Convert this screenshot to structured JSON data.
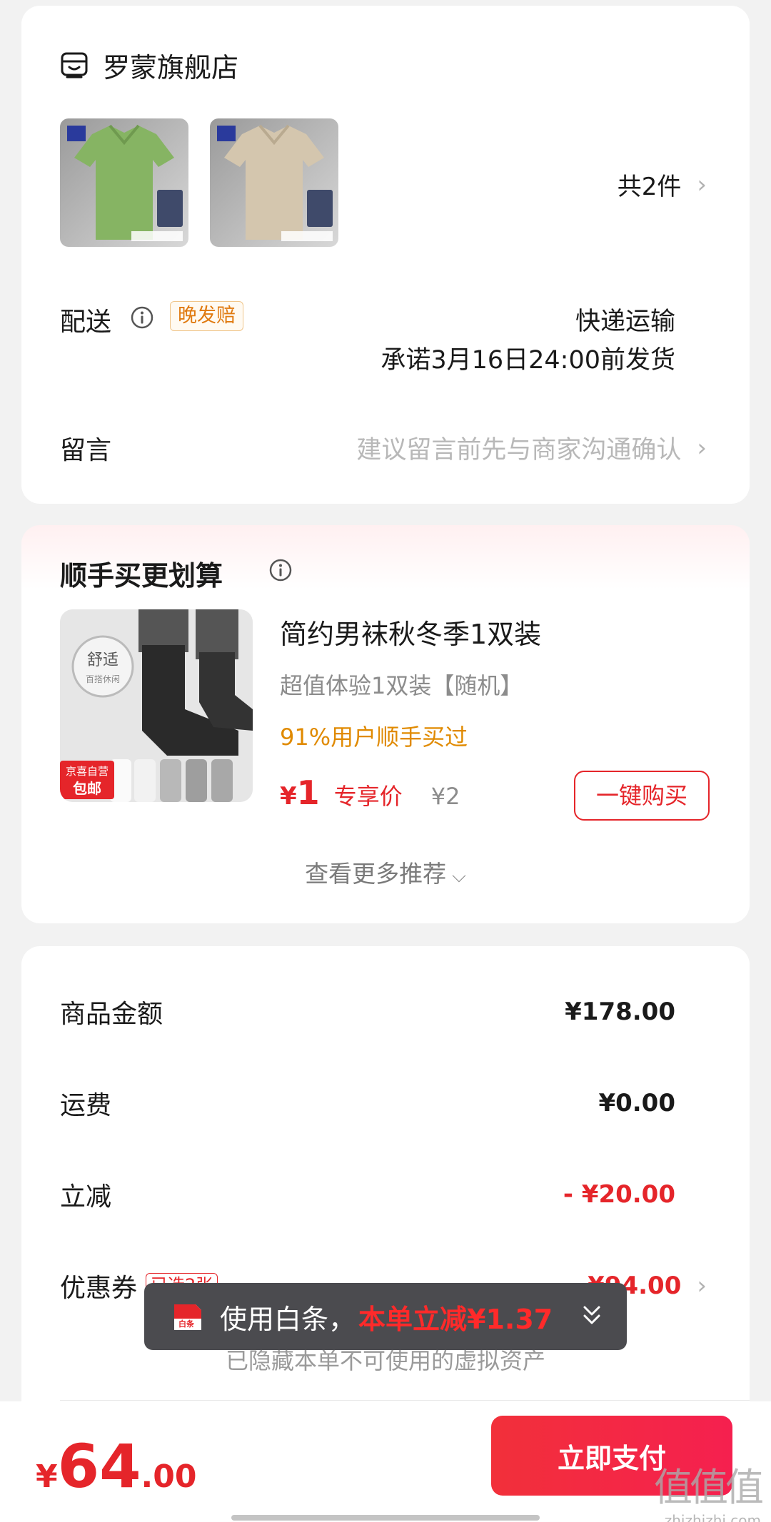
{
  "store": {
    "name": "罗蒙旗舰店",
    "item_count": "共2件",
    "thumb_brand": "罗蒙",
    "delivery_label": "配送",
    "late_badge": "晚发赔",
    "shipping_method": "快递运输",
    "shipping_promise": "承诺3月16日24:00前发货",
    "message_label": "留言",
    "message_placeholder": "建议留言前先与商家沟通确认"
  },
  "recommend": {
    "title": "顺手买更划算",
    "product_name": "简约男袜秋冬季1双装",
    "spec": "超值体验1双装【随机】",
    "bought_rate": "91%用户顺手买过",
    "currency": "¥",
    "price": "1",
    "price_tag": "专享价",
    "original_price": "¥2",
    "buy_button": "一键购买",
    "more_link": "查看更多推荐",
    "img_badge_top": "舒适",
    "img_badge_sub": "百搭休闲",
    "img_tag_1": "京喜自营",
    "img_tag_2": "包邮"
  },
  "summary": {
    "goods_label": "商品金额",
    "goods_value": "¥178.00",
    "freight_label": "运费",
    "freight_value": "¥0.00",
    "discount_label": "立减",
    "discount_value": "- ¥20.00",
    "coupon_label": "优惠券",
    "coupon_badge": "已选2张",
    "coupon_value": "-¥94.00",
    "hidden_assets": "已隐藏本单不可使用的虚拟资产"
  },
  "toast": {
    "icon_label": "白条",
    "text": "使用白条，",
    "highlight": "本单立减¥1.37"
  },
  "bottom": {
    "currency": "¥",
    "total_int": "64",
    "total_dec": ".00",
    "pay_button": "立即支付"
  },
  "watermark": {
    "main": "值值值",
    "sub": "zhizhizhi.com"
  },
  "colors": {
    "accent_red": "#e5252a",
    "orange": "#e08a00",
    "shirt_green": "#86b463",
    "shirt_beige": "#d4c6ae"
  }
}
